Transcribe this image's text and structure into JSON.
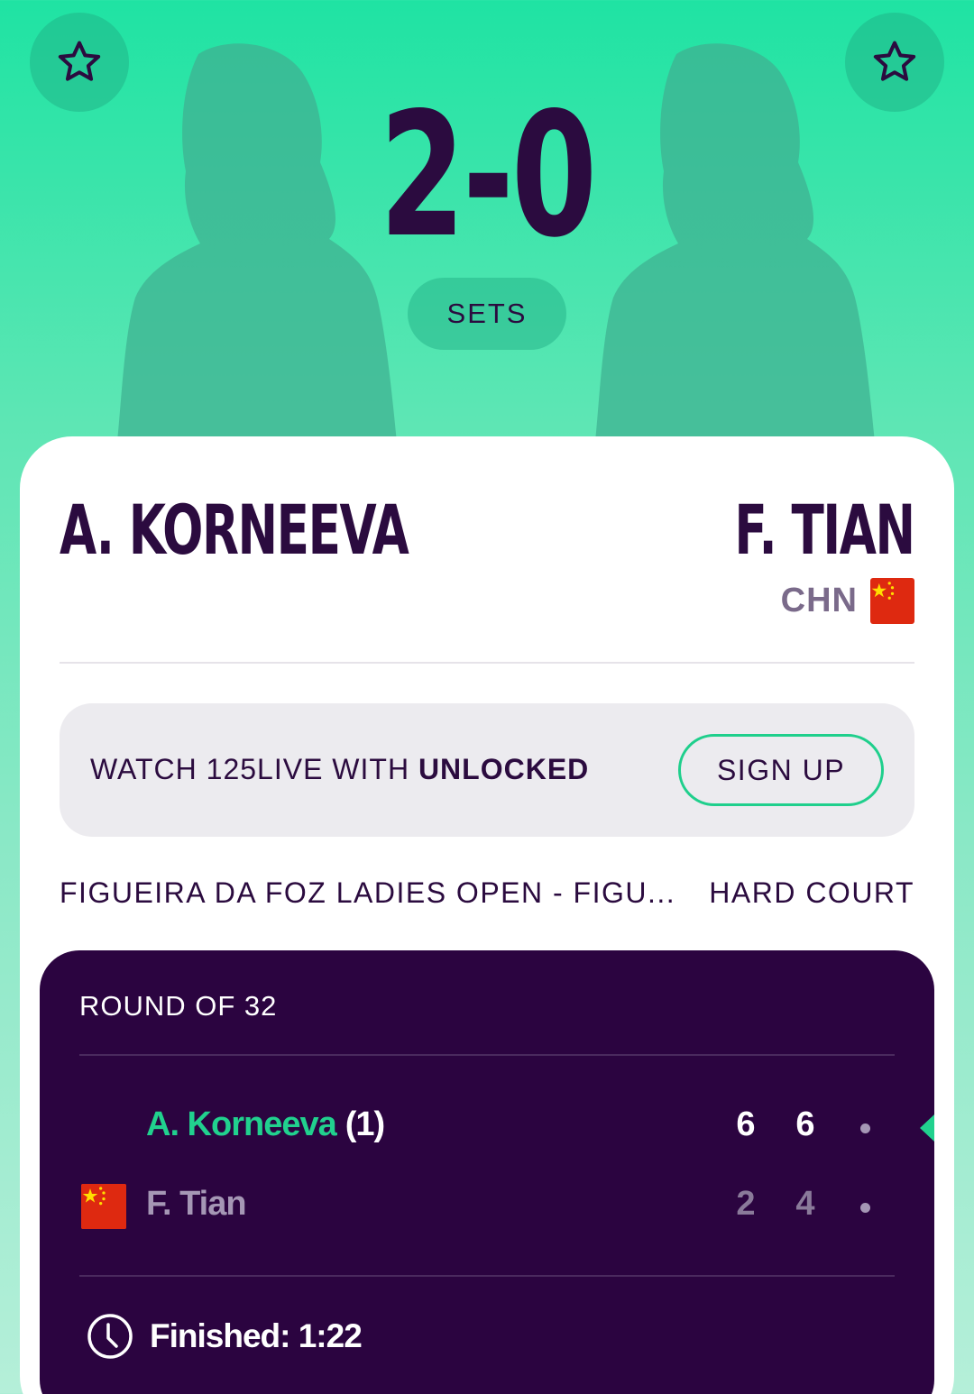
{
  "colors": {
    "background_top": "#1fe3a3",
    "background_bottom": "#b5efd9",
    "primary_dark": "#2b0b3f",
    "accent_green": "#21d18e",
    "panel": "#2b0440"
  },
  "header": {
    "score": "2-0",
    "score_unit": "SETS",
    "favorite_left_icon": "star-outline-icon",
    "favorite_right_icon": "star-outline-icon"
  },
  "players": {
    "home": {
      "name": "A. KORNEEVA"
    },
    "away": {
      "name": "F. TIAN",
      "country_code": "CHN",
      "flag_icon": "china-flag-icon"
    }
  },
  "promo": {
    "text_prefix": "WATCH 125LIVE WITH ",
    "text_bold": "UNLOCKED",
    "button_label": "SIGN UP"
  },
  "tournament": {
    "name": "FIGUEIRA DA FOZ LADIES OPEN - FIGU...",
    "surface": "HARD COURT"
  },
  "match": {
    "round": "ROUND OF 32",
    "rows": [
      {
        "name": "A. Korneeva",
        "seed": "(1)",
        "sets": [
          "6",
          "6"
        ],
        "winner": true
      },
      {
        "name": "F. Tian",
        "seed": "",
        "sets": [
          "2",
          "4"
        ],
        "winner": false
      }
    ],
    "status": "Finished: 1:22",
    "status_icon": "clock-icon"
  }
}
